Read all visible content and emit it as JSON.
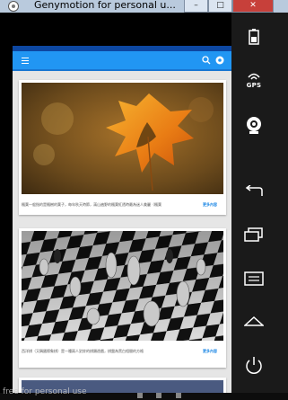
{
  "window": {
    "title": "Genymotion for personal u...",
    "minimize": "–",
    "maximize": "□",
    "close": "✕"
  },
  "side_panel": {
    "gps_label": "GPS",
    "buttons": [
      "battery-icon",
      "gps-icon",
      "camera-icon",
      "back-icon",
      "recent-apps-icon",
      "menu-icon",
      "home-icon",
      "power-icon"
    ]
  },
  "app": {
    "accent": "#2196f3",
    "status_bar_color": "#0d47a1"
  },
  "cards": [
    {
      "image": "maple-leaf",
      "text": "楓葉一般指的是楓樹的葉子，每年秋天時節，滿山遍野的楓葉紅透時最為迷人美麗（楓葉",
      "link": "更多內容"
    },
    {
      "image": "chess",
      "text": "西洋棋（又稱國際象棋）是一種兩人對弈的棋類遊戲，棋盤為黑白相間的方格",
      "link": "更多內容"
    }
  ],
  "watermark": "free for personal use"
}
